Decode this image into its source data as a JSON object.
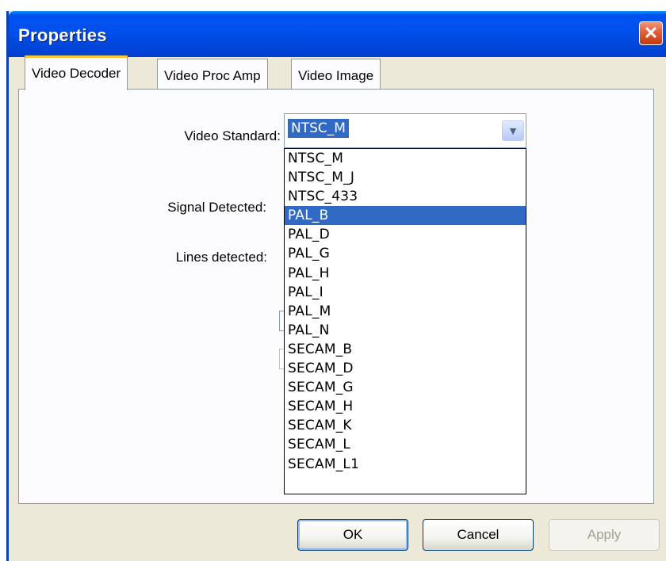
{
  "window": {
    "title": "Properties",
    "close_glyph": "✕"
  },
  "tabs": [
    {
      "label": "Video Decoder",
      "active": true
    },
    {
      "label": "Video Proc Amp",
      "active": false
    },
    {
      "label": "Video Image",
      "active": false
    }
  ],
  "fields": {
    "video_standard_label": "Video Standard:",
    "signal_detected_label": "Signal Detected:",
    "lines_detected_label": "Lines detected:"
  },
  "combo": {
    "value": "NTSC_M",
    "arrow_icon": "chevron-down-icon"
  },
  "dropdown": {
    "options": [
      "NTSC_M",
      "NTSC_M_J",
      "NTSC_433",
      "PAL_B",
      "PAL_D",
      "PAL_G",
      "PAL_H",
      "PAL_I",
      "PAL_M",
      "PAL_N",
      "SECAM_B",
      "SECAM_D",
      "SECAM_G",
      "SECAM_H",
      "SECAM_K",
      "SECAM_L",
      "SECAM_L1"
    ],
    "highlighted": "PAL_B"
  },
  "buttons": {
    "ok": "OK",
    "cancel": "Cancel",
    "apply": "Apply"
  },
  "colors": {
    "selection": "#316ac5",
    "titlebar": "#0050ee",
    "dialog": "#ECE9D8"
  }
}
